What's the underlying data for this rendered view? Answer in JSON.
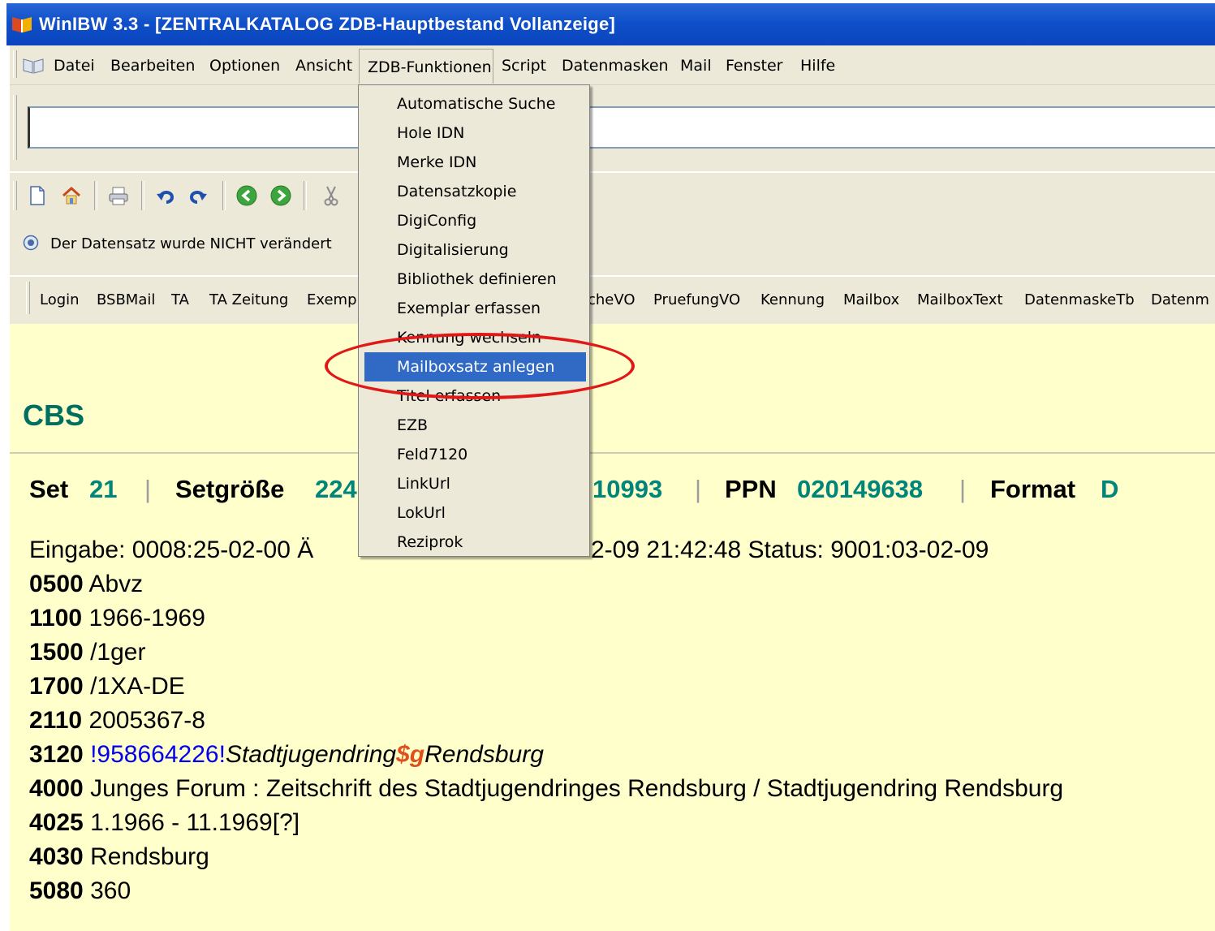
{
  "window": {
    "title": "WinIBW 3.3 - [ZENTRALKATALOG ZDB-Hauptbestand Vollanzeige]"
  },
  "menubar": {
    "items": [
      "Datei",
      "Bearbeiten",
      "Optionen",
      "Ansicht",
      "ZDB-Funktionen",
      "Script",
      "Datenmasken",
      "Mail",
      "Fenster",
      "Hilfe"
    ]
  },
  "command_input": {
    "value": ""
  },
  "status": {
    "text": "Der Datensatz wurde NICHT verändert"
  },
  "scriptbar": {
    "items": [
      "Login",
      "BSBMail",
      "TA",
      "TA Zeitung",
      "Exemp",
      "cheVO",
      "PruefungVO",
      "Kennung",
      "Mailbox",
      "MailboxText",
      "DatenmaskeTb",
      "Datenm"
    ]
  },
  "dropdown": {
    "items": [
      "Automatische Suche",
      "Hole IDN",
      "Merke IDN",
      "Datensatzkopie",
      "DigiConfig",
      "Digitalisierung",
      "Bibliothek definieren",
      "Exemplar erfassen",
      "Kennung wechseln",
      "Mailboxsatz anlegen",
      "Titel erfassen",
      "EZB",
      "Feld7120",
      "LinkUrl",
      "LokUrl",
      "Reziprok"
    ],
    "selected": "Mailboxsatz anlegen"
  },
  "content": {
    "heading": "CBS",
    "set_label": "Set",
    "set_value": "21",
    "setsize_label": "Setgröße",
    "setsize_value": "224",
    "hidden_value": "10993",
    "ppn_label": "PPN",
    "ppn_value": "020149638",
    "format_label": "Format",
    "format_value": "D",
    "eingabe_left": "Eingabe: 0008:25-02-00 Ä",
    "eingabe_right": "2-09 21:42:48 Status: 9001:03-02-09",
    "records": [
      {
        "tag": "0500",
        "text": "Abvz"
      },
      {
        "tag": "1100",
        "text": "1966-1969"
      },
      {
        "tag": "1500",
        "text": "/1ger"
      },
      {
        "tag": "1700",
        "text": "/1XA-DE"
      },
      {
        "tag": "2110",
        "text": "2005367-8"
      },
      {
        "tag": "3120",
        "link": "!958664226!",
        "italic1": "Stadtjugendring",
        "sub": "$g",
        "italic2": "Rendsburg"
      },
      {
        "tag": "4000",
        "text": "Junges Forum : Zeitschrift des Stadtjugendringes Rendsburg / Stadtjugendring Rendsburg"
      },
      {
        "tag": "4025",
        "text": "1.1966 - 11.1969[?]"
      },
      {
        "tag": "4030",
        "text": "Rendsburg"
      },
      {
        "tag": "5080",
        "text": "360"
      }
    ]
  },
  "colors": {
    "titlebar": "#0a45be",
    "chrome": "#ece9d8",
    "content_bg": "#ffffcc",
    "accent_green": "#00857a",
    "highlight": "#316ac5",
    "annotation": "#e01818"
  }
}
